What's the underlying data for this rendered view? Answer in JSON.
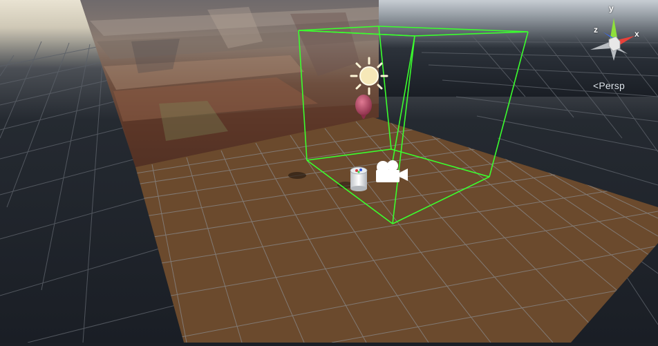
{
  "scene_view": {
    "projection_label": "<Persp",
    "gizmo": {
      "axis_labels": {
        "x": "x",
        "y": "y",
        "z": "z"
      },
      "colors": {
        "x": "#e8413a",
        "y": "#8ee03b",
        "z": "#3b6be8",
        "neutral": "#c8c8c8"
      }
    },
    "colors": {
      "sky_top": "#1d222a",
      "horizon": "#d8d4c8",
      "floor": "#6b4a2d",
      "grid_line": "#8a8f96",
      "selection_box": "#3bff2e"
    },
    "icons": [
      "sun-light-icon",
      "balloon-object",
      "cylinder-object",
      "camera-icon"
    ]
  }
}
